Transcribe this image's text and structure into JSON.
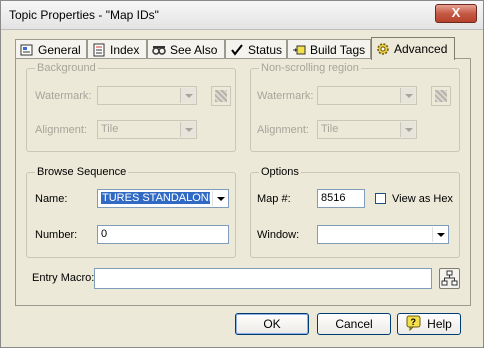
{
  "window": {
    "title": "Topic Properties - \"Map IDs\"",
    "close_label": "X"
  },
  "tabs": [
    {
      "label": "General",
      "icon": "general-icon"
    },
    {
      "label": "Index",
      "icon": "index-icon"
    },
    {
      "label": "See Also",
      "icon": "see-also-icon"
    },
    {
      "label": "Status",
      "icon": "checkmark-icon"
    },
    {
      "label": "Build Tags",
      "icon": "build-tags-icon"
    },
    {
      "label": "Advanced",
      "icon": "gear-icon",
      "active": true
    }
  ],
  "background": {
    "legend": "Background",
    "watermark_label": "Watermark:",
    "watermark_value": "",
    "alignment_label": "Alignment:",
    "alignment_value": "Tile"
  },
  "nonscrolling": {
    "legend": "Non-scrolling region",
    "watermark_label": "Watermark:",
    "watermark_value": "",
    "alignment_label": "Alignment:",
    "alignment_value": "Tile"
  },
  "browse": {
    "legend": "Browse Sequence",
    "name_label": "Name:",
    "name_value": "TURES STANDALONE",
    "number_label": "Number:",
    "number_value": "0"
  },
  "options": {
    "legend": "Options",
    "map_label": "Map #:",
    "map_value": "8516",
    "view_hex_label": "View as Hex",
    "view_hex_checked": false,
    "window_label": "Window:",
    "window_value": ""
  },
  "entry_macro": {
    "label": "Entry Macro:",
    "value": ""
  },
  "buttons": {
    "ok": "OK",
    "cancel": "Cancel",
    "help": "Help"
  },
  "colors": {
    "dialog_bg": "#ece9d8",
    "selection": "#316ac5",
    "close_button": "#c45a44"
  }
}
